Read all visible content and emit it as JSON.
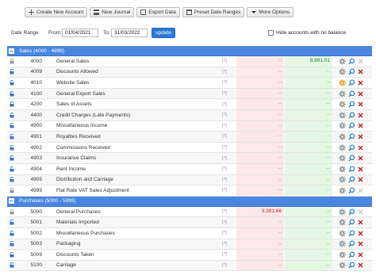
{
  "toolbar": {
    "create_label": "Create New Account",
    "journal_label": "New Journal",
    "export_label": "Export Data",
    "preset_label": "Preset Date Ranges",
    "more_label": "More Options"
  },
  "filters": {
    "date_range_label": "Date Range",
    "from_label": "From:",
    "from_value": "01/04/2021",
    "to_label": "To:",
    "to_value": "31/03/2022",
    "update_label": "update",
    "hide_label": "Hide accounts with no balance"
  },
  "groups": [
    {
      "title": "Sales (4000 - 4999)",
      "rows": [
        {
          "code": "4000",
          "name": "General Sales",
          "tick": "[?]",
          "debit": "--",
          "credit": "8,991.01",
          "locked": true,
          "gear_active": false,
          "deletable": false
        },
        {
          "code": "4009",
          "name": "Discounts Allowed",
          "tick": "[?]",
          "debit": "--",
          "credit": "--",
          "locked": false,
          "gear_active": false,
          "deletable": true
        },
        {
          "code": "4010",
          "name": "Website Sales",
          "tick": "[?]",
          "debit": "--",
          "credit": "--",
          "locked": false,
          "gear_active": true,
          "deletable": true
        },
        {
          "code": "4100",
          "name": "General Export Sales",
          "tick": "[?]",
          "debit": "--",
          "credit": "--",
          "locked": false,
          "gear_active": false,
          "deletable": true
        },
        {
          "code": "4200",
          "name": "Sales of Assets",
          "tick": "[?]",
          "debit": "--",
          "credit": "--",
          "locked": false,
          "gear_active": false,
          "deletable": true
        },
        {
          "code": "4400",
          "name": "Credit Charges (Late Payments)",
          "tick": "[?]",
          "debit": "--",
          "credit": "--",
          "locked": false,
          "gear_active": false,
          "deletable": true
        },
        {
          "code": "4900",
          "name": "Miscellaneous Income",
          "tick": "[?]",
          "debit": "--",
          "credit": "--",
          "locked": false,
          "gear_active": false,
          "deletable": true
        },
        {
          "code": "4901",
          "name": "Royalties Received",
          "tick": "[?]",
          "debit": "--",
          "credit": "--",
          "locked": false,
          "gear_active": false,
          "deletable": true
        },
        {
          "code": "4902",
          "name": "Commissions Received",
          "tick": "[?]",
          "debit": "--",
          "credit": "--",
          "locked": false,
          "gear_active": false,
          "deletable": true
        },
        {
          "code": "4903",
          "name": "Insurance Claims",
          "tick": "[?]",
          "debit": "--",
          "credit": "--",
          "locked": false,
          "gear_active": false,
          "deletable": true
        },
        {
          "code": "4904",
          "name": "Rent Income",
          "tick": "[?]",
          "debit": "--",
          "credit": "--",
          "locked": false,
          "gear_active": false,
          "deletable": true
        },
        {
          "code": "4905",
          "name": "Distribution and Carriage",
          "tick": "[?]",
          "debit": "--",
          "credit": "--",
          "locked": false,
          "gear_active": false,
          "deletable": true
        },
        {
          "code": "4999",
          "name": "Flat Rate VAT Sales Adjustment",
          "tick": "[?]",
          "debit": "--",
          "credit": "--",
          "locked": true,
          "gear_active": false,
          "deletable": false
        }
      ]
    },
    {
      "title": "Purchases (5000 - 5999)",
      "rows": [
        {
          "code": "5000",
          "name": "General Purchases",
          "tick": "[?]",
          "debit": "3,391.66",
          "credit": "--",
          "locked": true,
          "gear_active": false,
          "deletable": false
        },
        {
          "code": "5001",
          "name": "Materials Imported",
          "tick": "[?]",
          "debit": "--",
          "credit": "--",
          "locked": false,
          "gear_active": false,
          "deletable": true
        },
        {
          "code": "5002",
          "name": "Miscellaneous Purchases",
          "tick": "[?]",
          "debit": "--",
          "credit": "--",
          "locked": false,
          "gear_active": false,
          "deletable": true
        },
        {
          "code": "5003",
          "name": "Packaging",
          "tick": "[?]",
          "debit": "--",
          "credit": "--",
          "locked": false,
          "gear_active": false,
          "deletable": true
        },
        {
          "code": "5009",
          "name": "Discounts Taken",
          "tick": "[?]",
          "debit": "--",
          "credit": "--",
          "locked": false,
          "gear_active": false,
          "deletable": true
        },
        {
          "code": "5100",
          "name": "Carriage",
          "tick": "[?]",
          "debit": "--",
          "credit": "--",
          "locked": false,
          "gear_active": false,
          "deletable": true
        }
      ]
    }
  ],
  "colors": {
    "group_header": "#4a86e0",
    "debit_value": "#cc2222",
    "credit_value": "#1e8c1e",
    "active_gear": "#e8a317",
    "delete": "#cc2222"
  },
  "icons": {
    "row_lock": "lock-icon",
    "row_unlock": "unlock-icon",
    "settings": "gear-icon",
    "view": "magnifier-icon",
    "delete": "delete-x-icon"
  }
}
